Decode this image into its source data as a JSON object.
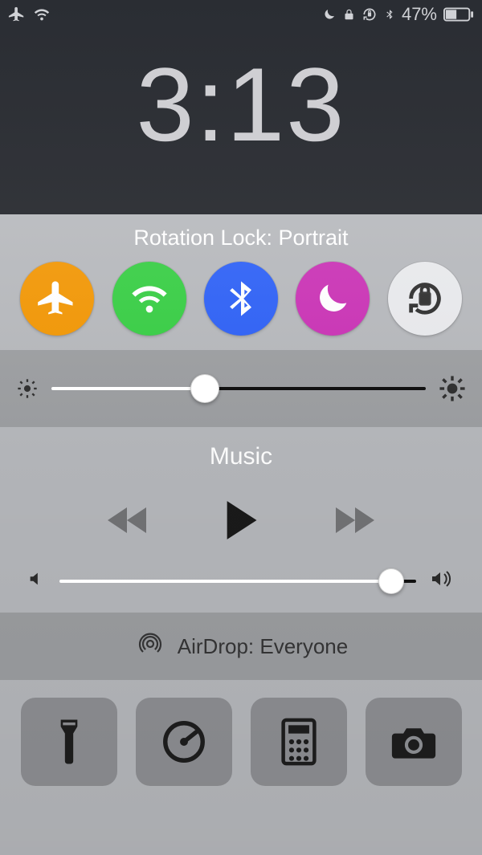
{
  "statusbar": {
    "battery_text": "47%"
  },
  "lockscreen": {
    "time": "3:13"
  },
  "cc": {
    "subtitle": "Rotation Lock: Portrait",
    "toggles": {
      "airplane_color": "#f29500",
      "wifi_color": "#34cd41",
      "bluetooth_color": "#2a5ef6",
      "dnd_color": "#c92fb4",
      "rotation_color": "#e8e9ec"
    },
    "brightness": {
      "value_pct": 41
    },
    "media": {
      "title": "Music",
      "volume_pct": 93
    },
    "airdrop_label": "AirDrop: Everyone"
  }
}
